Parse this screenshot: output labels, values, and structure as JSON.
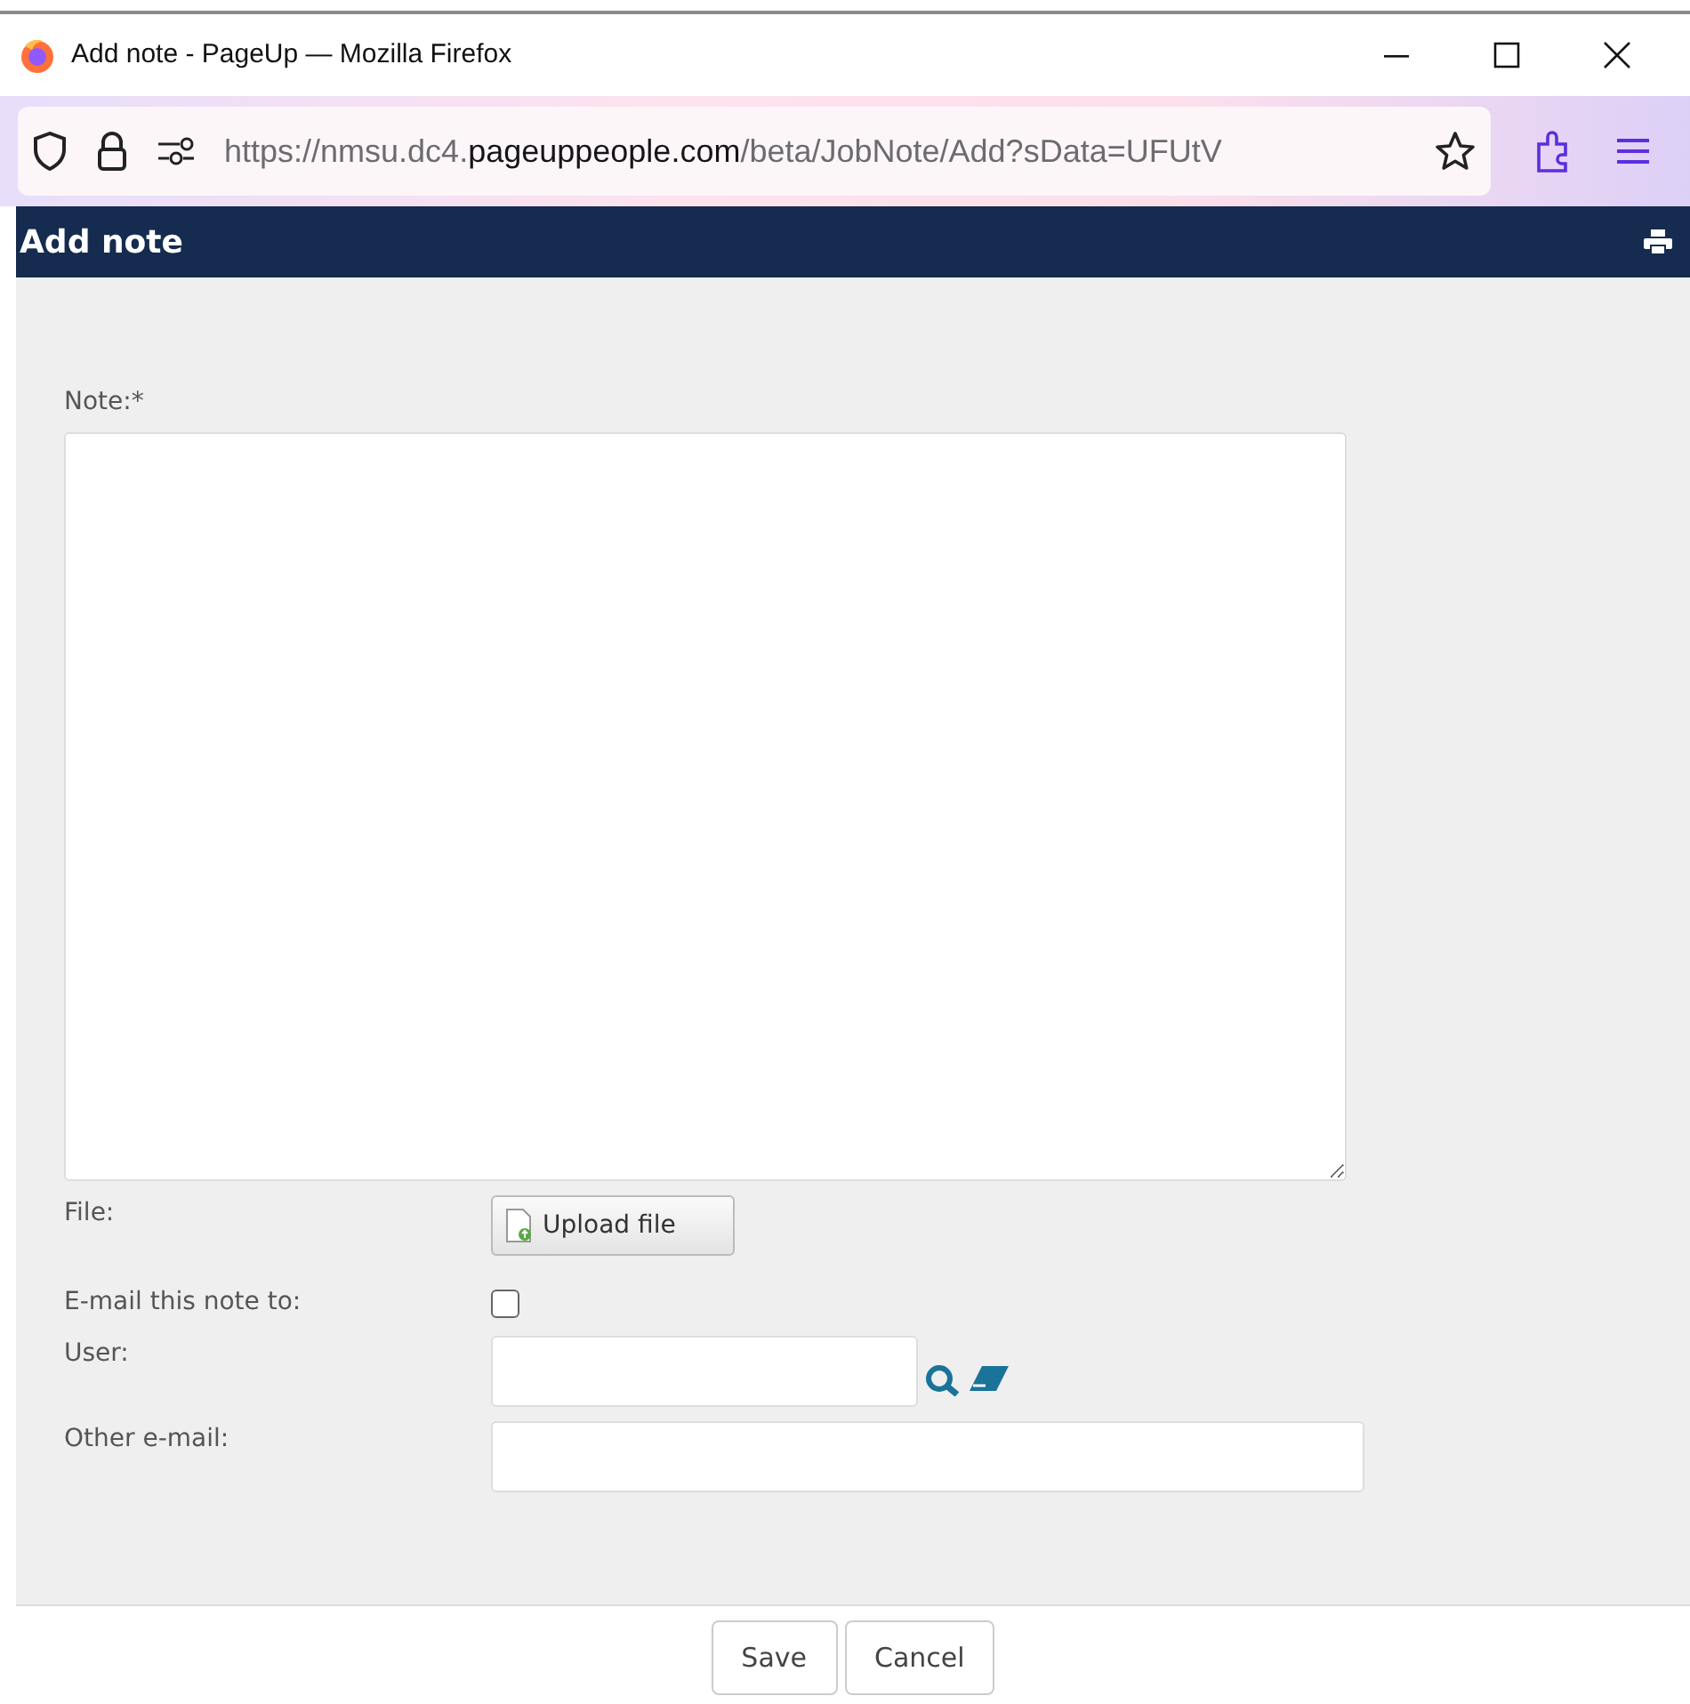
{
  "window": {
    "title": "Add note - PageUp — Mozilla Firefox"
  },
  "address_bar": {
    "url_prefix": "https://nmsu.dc4.",
    "url_domain": "pageuppeople.com",
    "url_path": "/beta/JobNote/Add?sData=UFUtV"
  },
  "header": {
    "title": "Add note"
  },
  "form": {
    "note_label": "Note:*",
    "file_label": "File:",
    "upload_button": "Upload file",
    "email_label": "E-mail this note to:",
    "email_checked": false,
    "user_label": "User:",
    "other_email_label": "Other e-mail:"
  },
  "buttons": [
    {
      "label": "Save"
    },
    {
      "label": "Cancel"
    }
  ]
}
